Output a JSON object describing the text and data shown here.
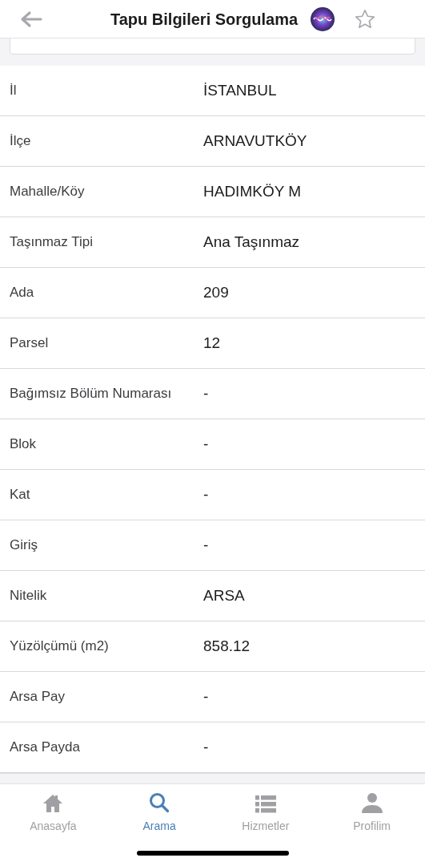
{
  "header": {
    "title": "Tapu Bilgileri Sorgulama"
  },
  "rows": [
    {
      "label": "İl",
      "value": "İSTANBUL"
    },
    {
      "label": "İlçe",
      "value": "ARNAVUTKÖY"
    },
    {
      "label": "Mahalle/Köy",
      "value": "HADIMKÖY M"
    },
    {
      "label": "Taşınmaz Tipi",
      "value": "Ana Taşınmaz"
    },
    {
      "label": "Ada",
      "value": "209"
    },
    {
      "label": "Parsel",
      "value": "12"
    },
    {
      "label": "Bağımsız Bölüm Numarası",
      "value": "-"
    },
    {
      "label": "Blok",
      "value": "-"
    },
    {
      "label": "Kat",
      "value": "-"
    },
    {
      "label": "Giriş",
      "value": "-"
    },
    {
      "label": "Nitelik",
      "value": "ARSA"
    },
    {
      "label": "Yüzölçümü (m2)",
      "value": "858.12"
    },
    {
      "label": "Arsa Pay",
      "value": "-"
    },
    {
      "label": "Arsa Payda",
      "value": "-"
    }
  ],
  "tab_bar": [
    {
      "kind": "home",
      "label": "Anasayfa",
      "selected": false
    },
    {
      "kind": "search",
      "label": "Arama",
      "selected": true
    },
    {
      "kind": "list",
      "label": "Hizmetler",
      "selected": false
    },
    {
      "kind": "person",
      "label": "Profilim",
      "selected": false
    }
  ]
}
